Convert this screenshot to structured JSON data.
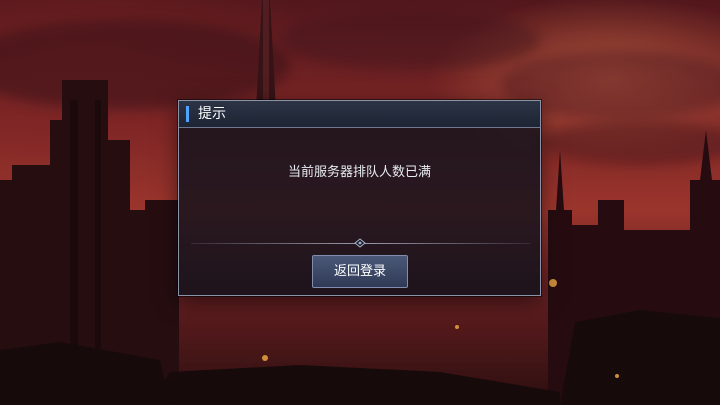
{
  "dialog": {
    "title": "提示",
    "message": "当前服务器排队人数已满",
    "button_label": "返回登录",
    "accent_color": "#4fa3ff"
  }
}
